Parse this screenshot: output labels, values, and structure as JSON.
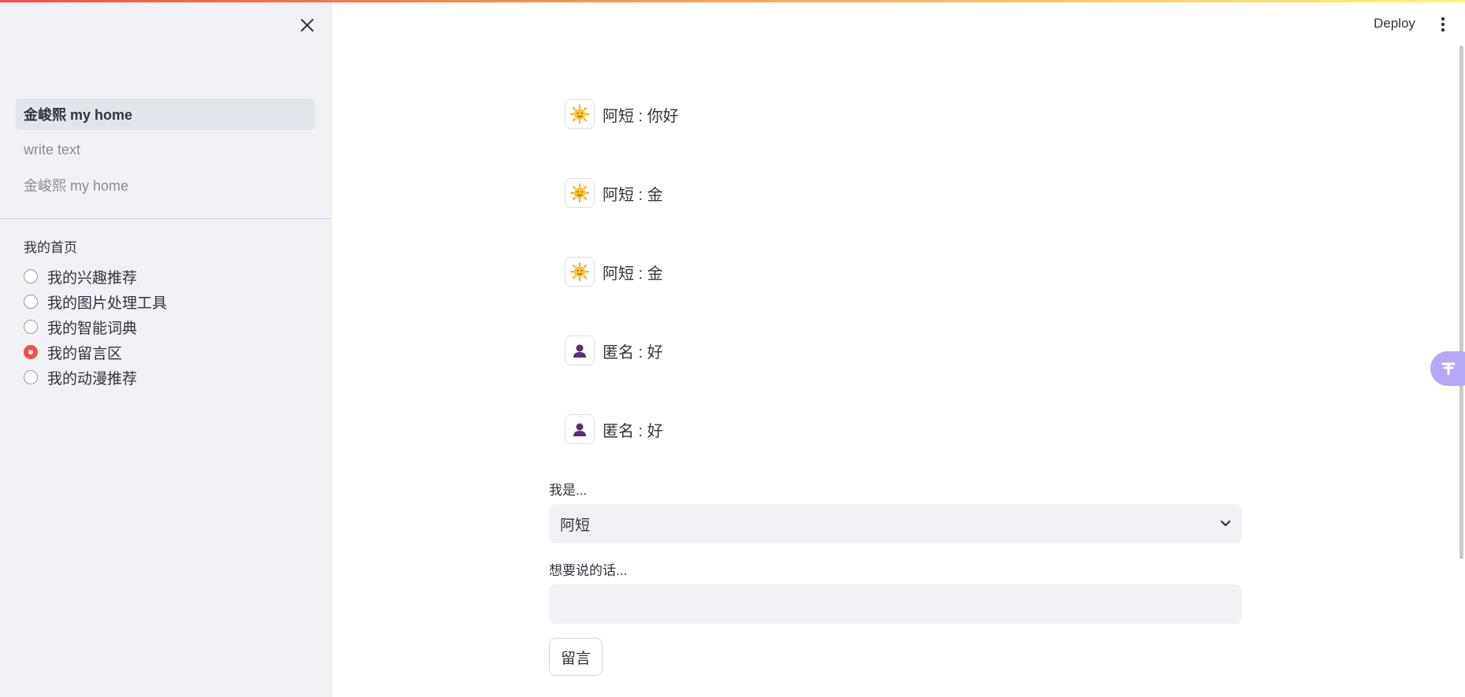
{
  "sidebar": {
    "nav_items": [
      {
        "label": "金峻熙 my home",
        "active": true
      },
      {
        "label": "write text",
        "active": false
      },
      {
        "label": "金峻熙 my home",
        "active": false
      }
    ],
    "radio_group": {
      "label": "我的首页",
      "options": [
        {
          "label": "我的兴趣推荐",
          "checked": false
        },
        {
          "label": "我的图片处理工具",
          "checked": false
        },
        {
          "label": "我的智能词典",
          "checked": false
        },
        {
          "label": "我的留言区",
          "checked": true
        },
        {
          "label": "我的动漫推荐",
          "checked": false
        }
      ]
    }
  },
  "header": {
    "deploy_label": "Deploy"
  },
  "messages": [
    {
      "avatar": "sun-emoji-icon",
      "text": "阿短 : 你好"
    },
    {
      "avatar": "sun-emoji-icon",
      "text": "阿短 : 金"
    },
    {
      "avatar": "sun-emoji-icon",
      "text": "阿短 : 金"
    },
    {
      "avatar": "person-icon",
      "text": "匿名 : 好"
    },
    {
      "avatar": "person-icon",
      "text": "匿名 : 好"
    }
  ],
  "form": {
    "identity_label": "我是...",
    "identity_value": "阿短",
    "message_label": "想要说的话...",
    "message_value": "",
    "submit_label": "留言"
  },
  "colors": {
    "accent": "#ff4b4b",
    "sidebar_bg": "#f0f2f6",
    "float_widget": "#b6a8f6",
    "person_icon": "#5b2f73"
  }
}
